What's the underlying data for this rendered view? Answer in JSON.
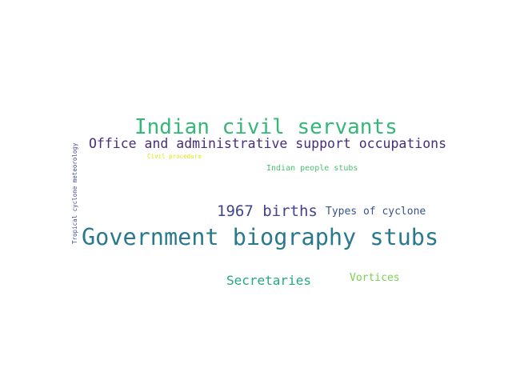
{
  "words": [
    {
      "text": "Indian civil servants",
      "color": "#35b779"
    },
    {
      "text": "Office and administrative support occupations",
      "color": "#472d7b"
    },
    {
      "text": "Civil procedure",
      "color": "#e2e418"
    },
    {
      "text": "Indian people stubs",
      "color": "#4ac16d"
    },
    {
      "text": "1967 births",
      "color": "#414487"
    },
    {
      "text": "Types of cyclone",
      "color": "#3b528b"
    },
    {
      "text": "Government biography stubs",
      "color": "#2a788e"
    },
    {
      "text": "Secretaries",
      "color": "#22a884"
    },
    {
      "text": "Vortices",
      "color": "#7ad151"
    },
    {
      "text": "Tropical cyclone meteorology",
      "color": "#3e4c8a"
    }
  ]
}
